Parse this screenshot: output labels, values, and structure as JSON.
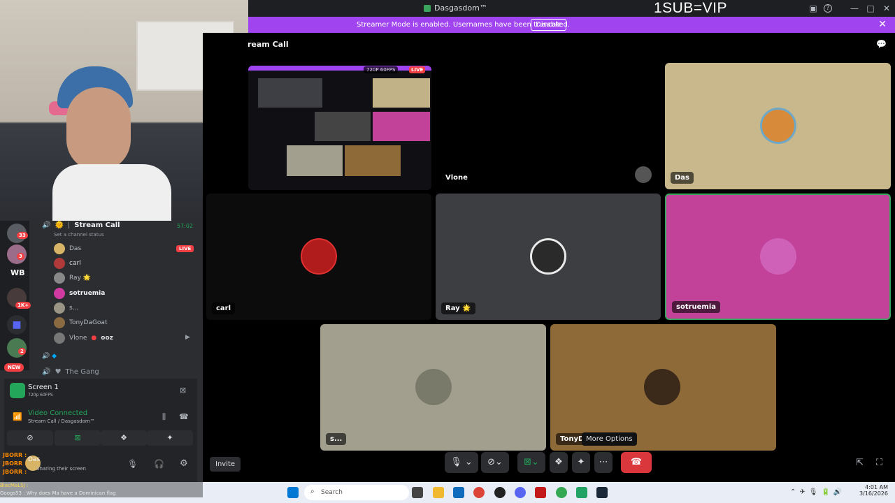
{
  "window": {
    "title": "Dasgasdom™",
    "overlay_text": "1SUB=VIP"
  },
  "banner": {
    "message": "Streamer Mode is enabled. Usernames have been truncated.",
    "button": "Disable"
  },
  "stage": {
    "channel_title": "ream Call",
    "stream_badge": "720P 60FPS",
    "live_label": "LIVE",
    "tiles": [
      {
        "name": "Vlone"
      },
      {
        "name": "Das"
      },
      {
        "name": "carl"
      },
      {
        "name": "Ray 🌟"
      },
      {
        "name": "sotruemia"
      },
      {
        "name": "s..."
      },
      {
        "name": "TonyD"
      }
    ],
    "tooltip": "More Options",
    "invite": "Invite"
  },
  "sidebar": {
    "channel_name": "Stream Call",
    "channel_time": "57:02",
    "channel_status": "Set a channel status",
    "members": [
      {
        "name": "Das",
        "live": "LIVE"
      },
      {
        "name": "carl"
      },
      {
        "name": "Ray 🌟"
      },
      {
        "name": "sotruemia"
      },
      {
        "name": "s..."
      },
      {
        "name": "TonyDaGoat"
      },
      {
        "name": "Vlone",
        "tag": "ooz"
      }
    ],
    "other_channel": "The Gang",
    "screen_title": "Screen 1",
    "screen_sub": "720p 60FPS",
    "voice_status": "Video Connected",
    "voice_channel": "Stream Call / Dasgasdom™",
    "user_name": "Das",
    "user_status": "Sharing their screen"
  },
  "guilds": {
    "badges": [
      "33",
      "3",
      "1K+",
      "2"
    ],
    "label_wb": "WB",
    "new": "NEW"
  },
  "chat_overlay": [
    "JBORR :",
    "JBORR :",
    "JBORR :"
  ],
  "chat_bottom": [
    "BlacMaLSJ :",
    "Googs53 :  Why does Ma have a Dominican flag"
  ],
  "taskbar": {
    "search": "Search",
    "time": "4:01 AM",
    "date": "3/16/2026"
  }
}
